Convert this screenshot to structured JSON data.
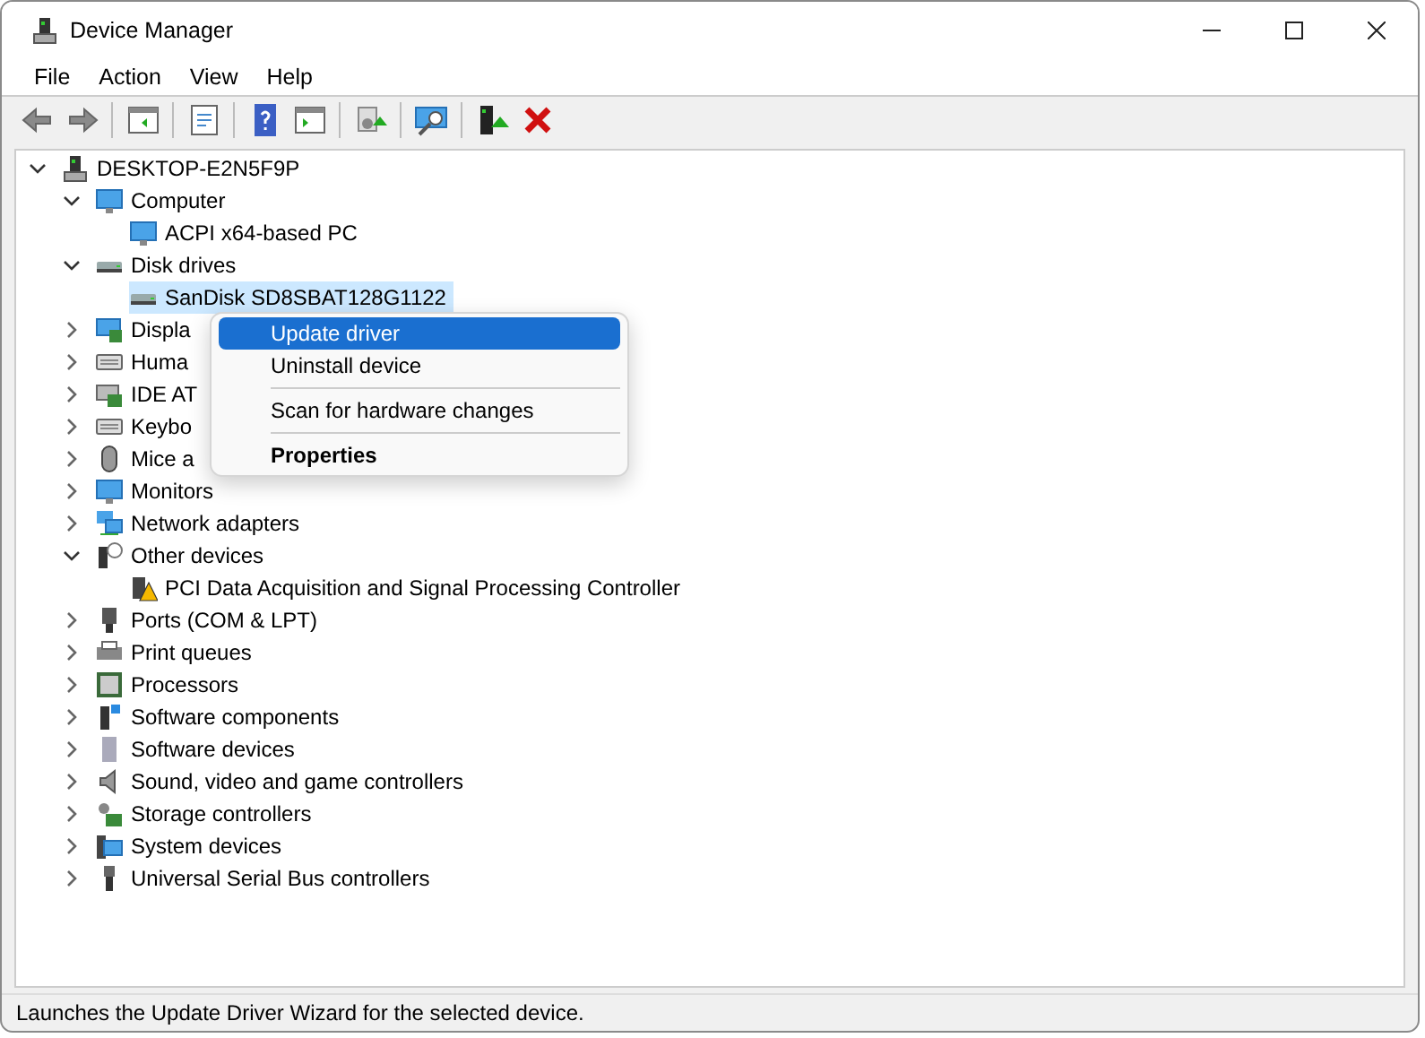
{
  "window": {
    "title": "Device Manager"
  },
  "menu_bar": [
    "File",
    "Action",
    "View",
    "Help"
  ],
  "toolbar": [
    {
      "kind": "back",
      "disabled": false
    },
    {
      "kind": "forward",
      "disabled": false
    },
    {
      "kind": "sep"
    },
    {
      "kind": "tree",
      "disabled": false
    },
    {
      "kind": "sep"
    },
    {
      "kind": "properties",
      "disabled": false
    },
    {
      "kind": "sep"
    },
    {
      "kind": "help",
      "disabled": false
    },
    {
      "kind": "pane",
      "disabled": false
    },
    {
      "kind": "sep"
    },
    {
      "kind": "update",
      "disabled": false
    },
    {
      "kind": "sep"
    },
    {
      "kind": "scan",
      "disabled": false
    },
    {
      "kind": "sep"
    },
    {
      "kind": "enable",
      "disabled": false
    },
    {
      "kind": "uninstall",
      "disabled": false
    }
  ],
  "tree": {
    "label": "DESKTOP-E2N5F9P",
    "kind": "pc",
    "expanded": true,
    "selected": false,
    "children": [
      {
        "label": "Computer",
        "kind": "monitor",
        "expanded": true,
        "selected": false,
        "children": [
          {
            "label": "ACPI x64-based PC",
            "kind": "monitor",
            "selected": false
          }
        ]
      },
      {
        "label": "Disk drives",
        "kind": "disk",
        "expanded": true,
        "selected": false,
        "children": [
          {
            "label": "SanDisk SD8SBAT128G1122",
            "kind": "disk",
            "selected": true
          }
        ]
      },
      {
        "label": "Displa",
        "kind": "display",
        "expanded": false,
        "selected": false
      },
      {
        "label": "Huma",
        "kind": "hid",
        "expanded": false,
        "selected": false
      },
      {
        "label": "IDE AT",
        "kind": "card",
        "expanded": false,
        "selected": false
      },
      {
        "label": "Keybo",
        "kind": "keyboard",
        "expanded": false,
        "selected": false
      },
      {
        "label": "Mice a",
        "kind": "mouse",
        "expanded": false,
        "selected": false
      },
      {
        "label": "Monitors",
        "kind": "monitor",
        "expanded": false,
        "selected": false
      },
      {
        "label": "Network adapters",
        "kind": "network",
        "expanded": false,
        "selected": false
      },
      {
        "label": "Other devices",
        "kind": "unknown",
        "expanded": true,
        "selected": false,
        "children": [
          {
            "label": "PCI Data Acquisition and Signal Processing Controller",
            "kind": "warning",
            "selected": false
          }
        ]
      },
      {
        "label": "Ports (COM & LPT)",
        "kind": "port",
        "expanded": false,
        "selected": false
      },
      {
        "label": "Print queues",
        "kind": "printer",
        "expanded": false,
        "selected": false
      },
      {
        "label": "Processors",
        "kind": "chip",
        "expanded": false,
        "selected": false
      },
      {
        "label": "Software components",
        "kind": "component",
        "expanded": false,
        "selected": false
      },
      {
        "label": "Software devices",
        "kind": "tower",
        "expanded": false,
        "selected": false
      },
      {
        "label": "Sound, video and game controllers",
        "kind": "speaker",
        "expanded": false,
        "selected": false
      },
      {
        "label": "Storage controllers",
        "kind": "storage",
        "expanded": false,
        "selected": false
      },
      {
        "label": "System devices",
        "kind": "system",
        "expanded": false,
        "selected": false
      },
      {
        "label": "Universal Serial Bus controllers",
        "kind": "usb",
        "expanded": false,
        "selected": false
      }
    ]
  },
  "context_menu": [
    {
      "kind": "item",
      "label": "Update driver",
      "selected": true,
      "bold": false
    },
    {
      "kind": "item",
      "label": "Uninstall device",
      "selected": false,
      "bold": false
    },
    {
      "kind": "separator"
    },
    {
      "kind": "item",
      "label": "Scan for hardware changes",
      "selected": false,
      "bold": false
    },
    {
      "kind": "separator"
    },
    {
      "kind": "item",
      "label": "Properties",
      "selected": false,
      "bold": true
    }
  ],
  "status_bar": "Launches the Update Driver Wizard for the selected device."
}
